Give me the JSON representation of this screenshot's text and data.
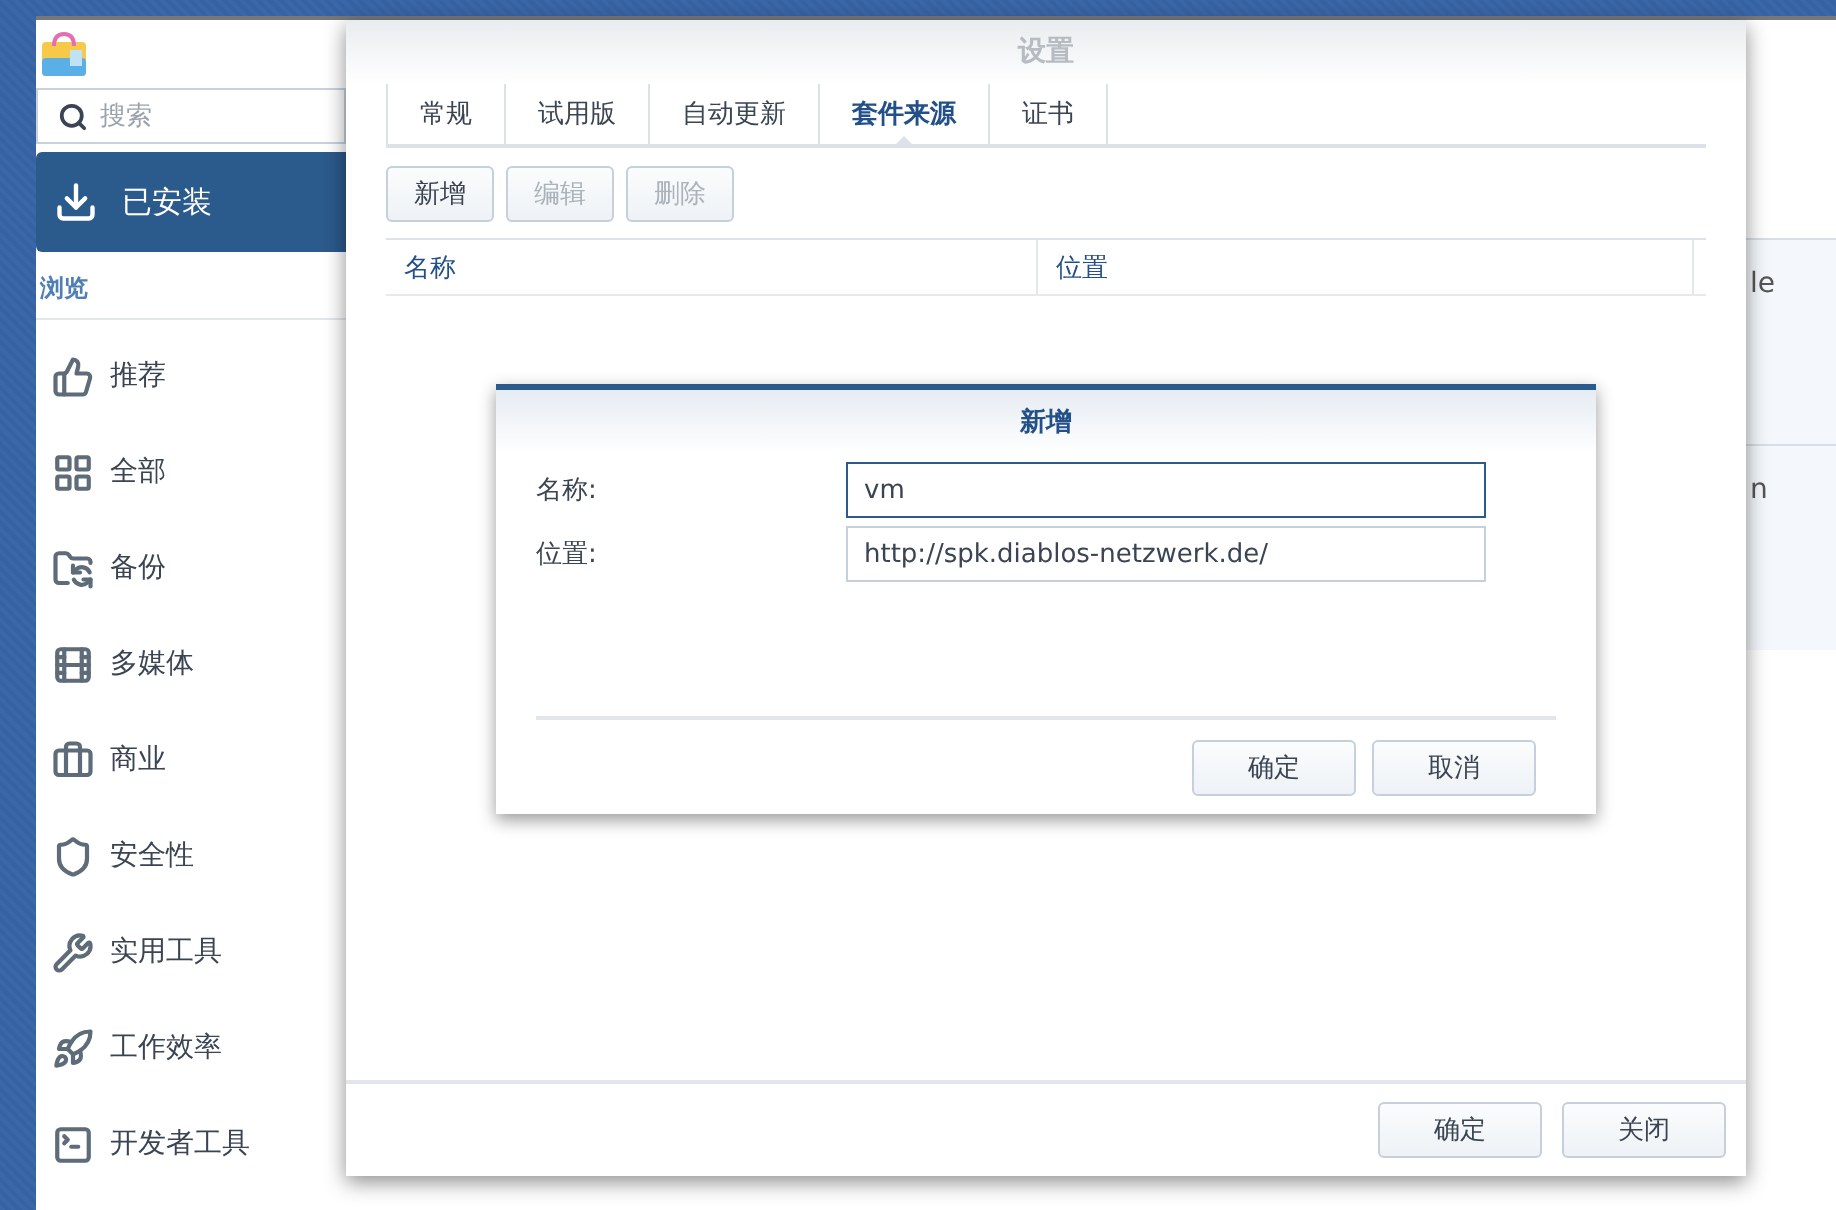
{
  "package_center": {
    "search": {
      "placeholder": "搜索"
    },
    "nav": [
      {
        "label": "已安装",
        "selected": true
      }
    ],
    "section": "浏览",
    "categories": [
      {
        "label": "推荐"
      },
      {
        "label": "全部"
      },
      {
        "label": "备份"
      },
      {
        "label": "多媒体"
      },
      {
        "label": "商业"
      },
      {
        "label": "安全性"
      },
      {
        "label": "实用工具"
      },
      {
        "label": "工作效率"
      },
      {
        "label": "开发者工具"
      }
    ],
    "list_fragments": [
      "le",
      "n"
    ]
  },
  "settings": {
    "title": "设置",
    "tabs": [
      {
        "label": "常规",
        "selected": false
      },
      {
        "label": "试用版",
        "selected": false
      },
      {
        "label": "自动更新",
        "selected": false
      },
      {
        "label": "套件来源",
        "selected": true
      },
      {
        "label": "证书",
        "selected": false
      }
    ],
    "toolbar": [
      {
        "label": "新增",
        "disabled": false
      },
      {
        "label": "编辑",
        "disabled": true
      },
      {
        "label": "删除",
        "disabled": true
      }
    ],
    "table": {
      "columns": [
        "名称",
        "位置"
      ]
    },
    "buttons": [
      "确定",
      "关闭"
    ]
  },
  "dialog": {
    "title": "新增",
    "fields": [
      {
        "label": "名称:",
        "value": "vm",
        "focused": true
      },
      {
        "label": "位置:",
        "value": "http://spk.diablos-netzwerk.de/",
        "focused": false
      }
    ],
    "buttons": [
      "确定",
      "取消"
    ]
  }
}
